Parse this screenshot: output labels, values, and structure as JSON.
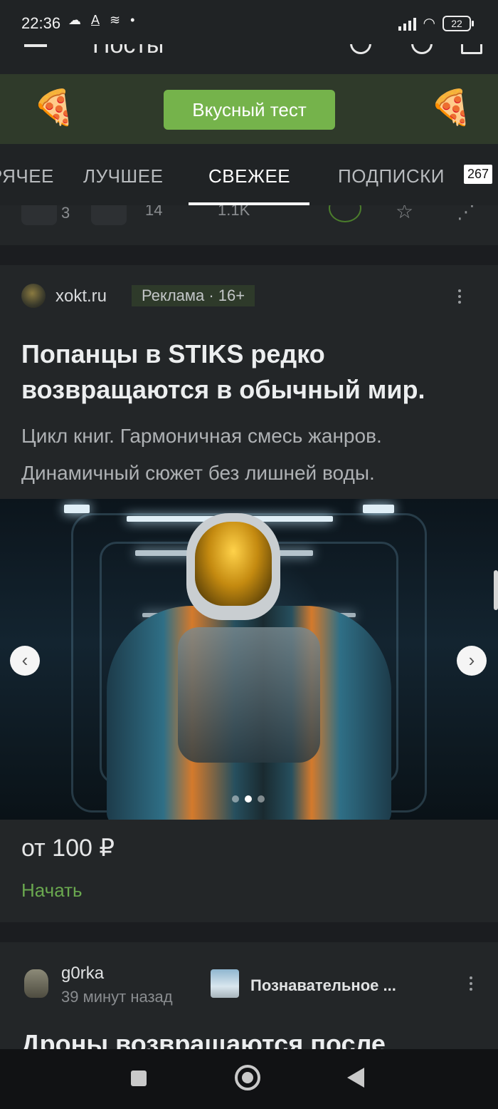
{
  "status": {
    "time": "22:36",
    "battery": "22"
  },
  "appbar": {
    "title": "Посты"
  },
  "promo": {
    "button_label": "Вкусный тест",
    "left_emoji": "🍕",
    "right_emoji": "🍕"
  },
  "tabs": {
    "items": [
      {
        "label": "ГОРЯЧЕЕ"
      },
      {
        "label": "ЛУЧШЕЕ"
      },
      {
        "label": "СВЕЖЕЕ"
      },
      {
        "label": "ПОДПИСКИ"
      }
    ],
    "subscriptions_count": "267"
  },
  "prev_post": {
    "votes": "3",
    "comments": "14",
    "views": "1.1K"
  },
  "ad": {
    "source": "xokt.ru",
    "badge": "Реклама · 16+",
    "title": "Попанцы в STIKS редко возвращаются в обычный мир.",
    "description": "Цикл книг. Гармоничная смесь жанров. Динамичный сюжет без лишней воды.",
    "price": "от 100 ₽",
    "cta": "Начать",
    "carousel_active_index": 1,
    "carousel_count": 3
  },
  "post": {
    "author": "g0rka",
    "time": "39 минут назад",
    "community": "Познавательное ...",
    "title": "Дроны возвращаются после"
  },
  "colors": {
    "accent_green": "#75b34b",
    "cta_green": "#6aa84f",
    "background": "#1b1d20"
  }
}
